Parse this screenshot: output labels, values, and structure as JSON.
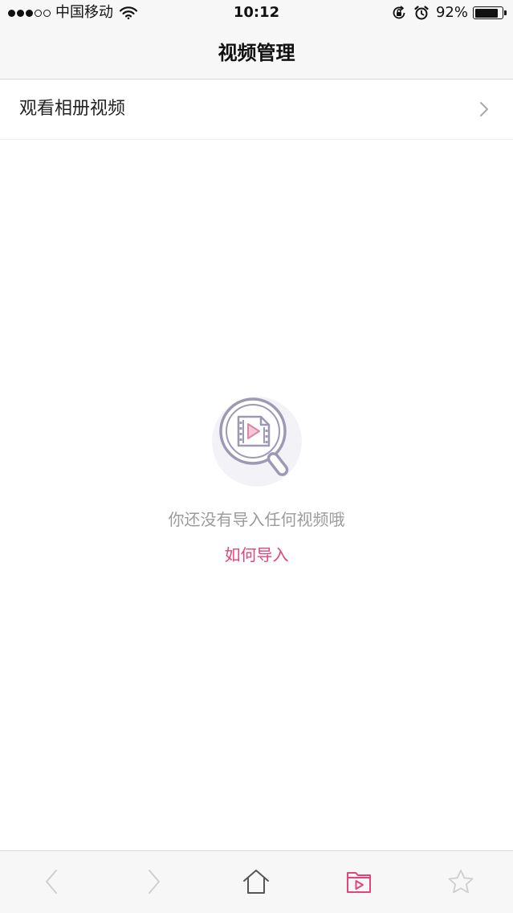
{
  "status_bar": {
    "carrier": "中国移动",
    "time": "10:12",
    "battery_percent": "92%",
    "battery_level": 0.92,
    "signal_bars_filled": 3,
    "signal_bars_total": 5,
    "icons": [
      "wifi-icon",
      "orientation-lock-icon",
      "alarm-icon",
      "battery-icon"
    ]
  },
  "nav": {
    "title": "视频管理"
  },
  "list": {
    "album_videos_label": "观看相册视频",
    "chevron_icon": "chevron-right-icon"
  },
  "empty_state": {
    "message": "你还没有导入任何视频哦",
    "link": "如何导入",
    "illustration_icon": "video-search-icon"
  },
  "toolbar": {
    "buttons": [
      {
        "name": "back",
        "icon": "chevron-left-icon",
        "enabled": false
      },
      {
        "name": "forward",
        "icon": "chevron-right-icon",
        "enabled": false
      },
      {
        "name": "home",
        "icon": "home-icon",
        "enabled": true
      },
      {
        "name": "video-folder",
        "icon": "video-folder-icon",
        "active": true
      },
      {
        "name": "favorites",
        "icon": "star-icon",
        "enabled": false
      }
    ]
  },
  "colors": {
    "accent": "#e0467a",
    "bar_background": "#f7f7f7",
    "muted_text": "#9b9b9b",
    "illustration_stroke": "#9d98b4",
    "illustration_bg": "#f3f2f6"
  }
}
